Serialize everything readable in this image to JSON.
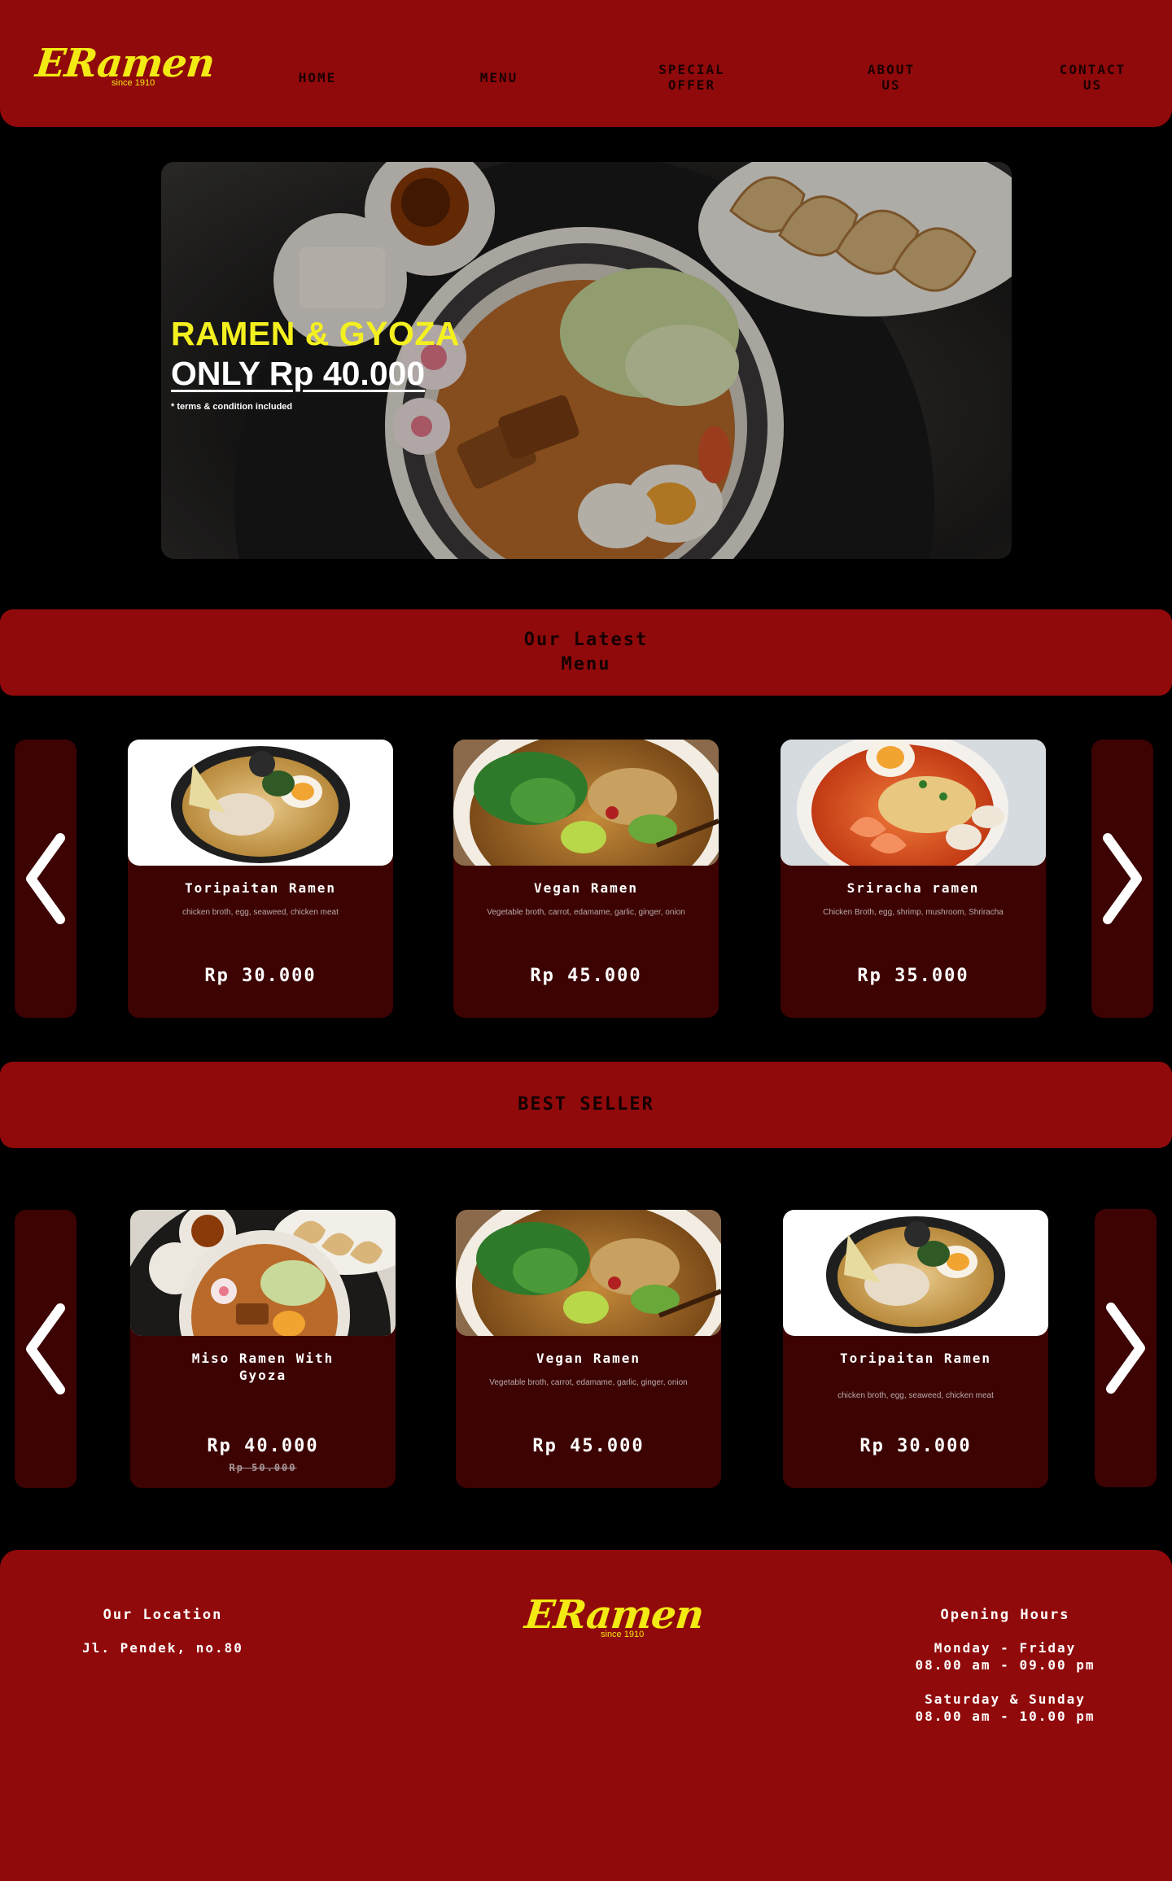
{
  "brand": {
    "name": "ERamen",
    "tagline": "since 1910"
  },
  "nav": {
    "home": "HOME",
    "menu": "MENU",
    "special_offer": "SPECIAL\nOFFER",
    "about_us": "ABOUT\nUS",
    "contact_us": "CONTACT\nUS"
  },
  "hero": {
    "title": "RAMEN & GYOZA",
    "price": "ONLY Rp 40.000",
    "terms": "* terms & condition included"
  },
  "latest": {
    "heading": "Our Latest\nMenu",
    "items": [
      {
        "name": "Toripaitan Ramen",
        "desc": "chicken broth, egg, seaweed, chicken meat",
        "price": "Rp 30.000",
        "image": "toripaitan-ramen"
      },
      {
        "name": "Vegan Ramen",
        "desc": "Vegetable broth, carrot, edamame, garlic, ginger, onion",
        "price": "Rp 45.000",
        "image": "vegan-ramen"
      },
      {
        "name": "Sriracha ramen",
        "desc": "Chicken Broth, egg, shrimp, mushroom, Shriracha",
        "price": "Rp 35.000",
        "image": "sriracha-ramen"
      }
    ]
  },
  "bestseller": {
    "heading": "BEST SELLER",
    "items": [
      {
        "name": "Miso Ramen With\nGyoza",
        "desc": "",
        "price": "Rp 40.000",
        "old_price": "Rp 50.000",
        "image": "miso-ramen-gyoza"
      },
      {
        "name": "Vegan Ramen",
        "desc": "Vegetable broth, carrot, edamame, garlic, ginger, onion",
        "price": "Rp 45.000",
        "image": "vegan-ramen"
      },
      {
        "name": "Toripaitan Ramen",
        "desc": "chicken broth, egg, seaweed, chicken meat",
        "price": "Rp 30.000",
        "image": "toripaitan-ramen"
      }
    ]
  },
  "footer": {
    "location_heading": "Our Location",
    "address": "Jl. Pendek, no.80",
    "hours_heading": "Opening Hours",
    "weekday_label": "Monday - Friday",
    "weekday_hours": "08.00 am - 09.00 pm",
    "weekend_label": "Saturday & Sunday",
    "weekend_hours": "08.00 am - 10.00 pm"
  },
  "icons": {
    "prev": "chevron-left-icon",
    "next": "chevron-right-icon"
  },
  "colors": {
    "primary_red": "#910a0b",
    "card_bg": "#3d0303",
    "accent_yellow": "#f3ea14",
    "background": "#000000"
  }
}
